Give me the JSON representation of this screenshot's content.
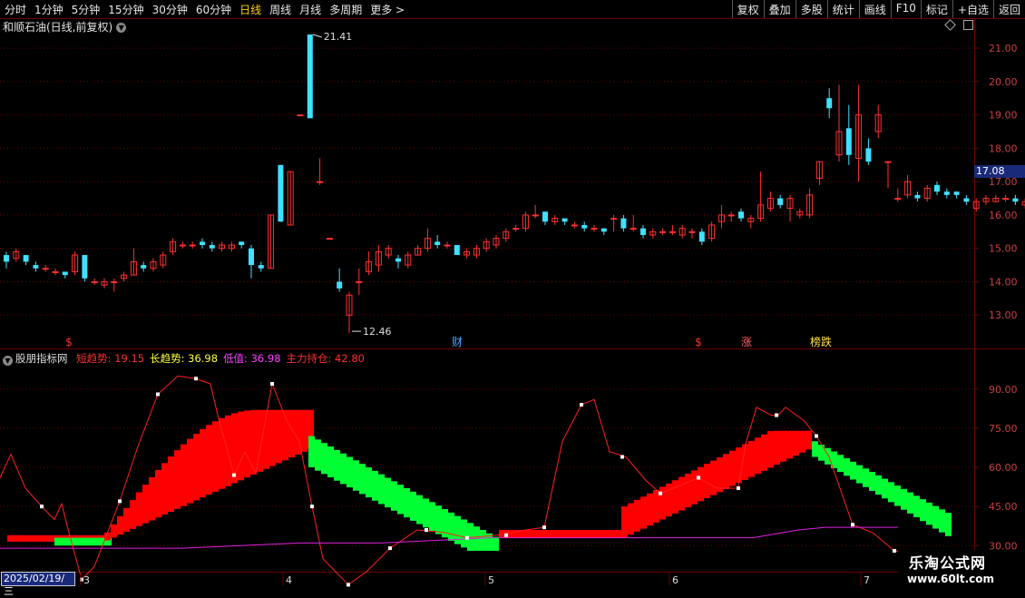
{
  "toolbar": {
    "periods": [
      "分时",
      "1分钟",
      "5分钟",
      "15分钟",
      "30分钟",
      "60分钟",
      "日线",
      "周线",
      "月线",
      "多周期",
      "更多 >"
    ],
    "active_period": "日线",
    "right_buttons": [
      "复权",
      "叠加",
      "多股",
      "统计",
      "画线",
      "F10",
      "标记",
      "+自选",
      "返回"
    ]
  },
  "chart_title": "和顺石油(日线,前复权)",
  "current_price": "17.08",
  "price_axis": {
    "ticks": [
      "21.00",
      "20.00",
      "19.00",
      "18.00",
      "17.00",
      "16.00",
      "15.00",
      "14.00",
      "13.00"
    ]
  },
  "annotations": {
    "high": "21.41",
    "low": "12.46"
  },
  "event_markers": [
    {
      "text": "$",
      "color": "#ff3030"
    },
    {
      "text": "财",
      "color": "#4aa8ff"
    },
    {
      "text": "$",
      "color": "#ff3030"
    },
    {
      "text": "涨",
      "color": "#ff6060"
    },
    {
      "text": "榜跌",
      "color": "#ffe040"
    }
  ],
  "indicator": {
    "name": "股朋指标网",
    "items": [
      {
        "label": "短趋势:",
        "value": "19.15",
        "color": "#ff3030"
      },
      {
        "label": "长趋势:",
        "value": "36.98",
        "color": "#ffff40"
      },
      {
        "label": "低值:",
        "value": "36.98",
        "color": "#ff40ff"
      },
      {
        "label": "主力持仓:",
        "value": "42.80",
        "color": "#ff3030"
      }
    ],
    "axis_ticks": [
      "90.00",
      "75.00",
      "60.00",
      "45.00",
      "30.00"
    ]
  },
  "date_axis": {
    "current_date": "2025/02/19/三",
    "months": [
      "3",
      "4",
      "5",
      "6",
      "7"
    ]
  },
  "watermark": {
    "name": "乐淘公式网",
    "url": "www.60lt.com"
  },
  "colors": {
    "up": "#ff3030",
    "down": "#40e0ff",
    "bull_band": "#ff0000",
    "bear_band": "#00ff33",
    "grid": "#6b0000"
  },
  "chart_data": {
    "type": "candlestick",
    "price_range": [
      12.0,
      21.9
    ],
    "candles": [
      [
        14.8,
        14.6,
        14.9,
        14.4
      ],
      [
        14.7,
        14.9,
        15.0,
        14.6
      ],
      [
        14.8,
        14.6,
        14.8,
        14.5
      ],
      [
        14.5,
        14.4,
        14.6,
        14.3
      ],
      [
        14.4,
        14.4,
        14.5,
        14.3
      ],
      [
        14.3,
        14.3,
        14.4,
        14.2
      ],
      [
        14.3,
        14.2,
        14.3,
        14.1
      ],
      [
        14.3,
        14.8,
        14.9,
        14.2
      ],
      [
        14.8,
        14.1,
        14.8,
        14.0
      ],
      [
        14.0,
        14.0,
        14.1,
        13.9
      ],
      [
        13.9,
        14.0,
        14.1,
        13.8
      ],
      [
        14.0,
        14.0,
        14.1,
        13.7
      ],
      [
        14.1,
        14.2,
        14.3,
        14.0
      ],
      [
        14.2,
        14.6,
        15.0,
        14.2
      ],
      [
        14.5,
        14.4,
        14.6,
        14.3
      ],
      [
        14.4,
        14.6,
        14.7,
        14.3
      ],
      [
        14.5,
        14.8,
        14.9,
        14.4
      ],
      [
        14.9,
        15.2,
        15.3,
        14.8
      ],
      [
        15.1,
        15.1,
        15.2,
        15.0
      ],
      [
        15.1,
        15.1,
        15.2,
        15.0
      ],
      [
        15.2,
        15.1,
        15.3,
        15.0
      ],
      [
        15.1,
        15.0,
        15.2,
        14.9
      ],
      [
        15.0,
        15.1,
        15.2,
        14.9
      ],
      [
        15.0,
        15.1,
        15.2,
        14.9
      ],
      [
        15.2,
        15.1,
        15.2,
        15.0
      ],
      [
        15.0,
        14.5,
        15.1,
        14.1
      ],
      [
        14.5,
        14.4,
        14.6,
        14.3
      ],
      [
        14.4,
        16.0,
        16.0,
        14.4
      ],
      [
        17.5,
        15.8,
        17.5,
        15.8
      ],
      [
        15.7,
        17.3,
        17.3,
        15.7
      ],
      [
        19.0,
        19.0,
        19.0,
        19.0
      ],
      [
        21.41,
        18.9,
        21.41,
        18.9
      ],
      [
        17.0,
        17.0,
        17.7,
        16.9
      ],
      [
        15.3,
        15.3,
        15.3,
        15.3
      ],
      [
        14.0,
        13.8,
        14.4,
        13.7
      ],
      [
        13.0,
        13.6,
        13.7,
        12.46
      ],
      [
        14.0,
        14.0,
        14.4,
        13.6
      ],
      [
        14.3,
        14.6,
        14.9,
        14.2
      ],
      [
        14.5,
        14.9,
        15.1,
        14.3
      ],
      [
        14.8,
        15.0,
        15.1,
        14.7
      ],
      [
        14.7,
        14.6,
        14.8,
        14.4
      ],
      [
        14.5,
        14.8,
        14.9,
        14.4
      ],
      [
        14.8,
        15.0,
        15.1,
        14.8
      ],
      [
        15.0,
        15.3,
        15.6,
        14.9
      ],
      [
        15.2,
        15.1,
        15.4,
        15.0
      ],
      [
        15.1,
        15.1,
        15.2,
        15.0
      ],
      [
        15.1,
        14.8,
        15.1,
        14.8
      ],
      [
        14.8,
        14.9,
        15.0,
        14.7
      ],
      [
        14.8,
        15.0,
        15.1,
        14.7
      ],
      [
        15.0,
        15.2,
        15.3,
        14.9
      ],
      [
        15.1,
        15.3,
        15.4,
        15.0
      ],
      [
        15.3,
        15.5,
        15.6,
        15.2
      ],
      [
        15.6,
        15.6,
        15.7,
        15.5
      ],
      [
        15.6,
        16.0,
        16.1,
        15.5
      ],
      [
        16.0,
        16.0,
        16.3,
        15.9
      ],
      [
        16.1,
        15.8,
        16.1,
        15.7
      ],
      [
        15.8,
        15.9,
        16.0,
        15.7
      ],
      [
        15.9,
        15.8,
        15.9,
        15.7
      ],
      [
        15.7,
        15.7,
        15.8,
        15.6
      ],
      [
        15.7,
        15.6,
        15.8,
        15.5
      ],
      [
        15.6,
        15.6,
        15.7,
        15.5
      ],
      [
        15.6,
        15.5,
        15.6,
        15.4
      ],
      [
        15.9,
        15.9,
        16.0,
        15.5
      ],
      [
        15.9,
        15.6,
        16.0,
        15.5
      ],
      [
        15.6,
        15.6,
        16.0,
        15.5
      ],
      [
        15.6,
        15.4,
        15.7,
        15.3
      ],
      [
        15.4,
        15.5,
        15.6,
        15.3
      ],
      [
        15.5,
        15.5,
        15.6,
        15.4
      ],
      [
        15.5,
        15.5,
        15.7,
        15.4
      ],
      [
        15.4,
        15.6,
        15.7,
        15.3
      ],
      [
        15.5,
        15.5,
        15.6,
        15.3
      ],
      [
        15.5,
        15.2,
        15.6,
        15.1
      ],
      [
        15.3,
        15.7,
        15.8,
        15.2
      ],
      [
        15.8,
        16.0,
        16.3,
        15.6
      ],
      [
        16.0,
        16.0,
        16.1,
        15.8
      ],
      [
        16.1,
        15.9,
        16.2,
        15.8
      ],
      [
        15.8,
        15.9,
        16.0,
        15.6
      ],
      [
        15.9,
        16.3,
        17.3,
        15.8
      ],
      [
        16.2,
        16.5,
        16.7,
        16.1
      ],
      [
        16.5,
        16.3,
        16.6,
        16.2
      ],
      [
        16.2,
        16.5,
        16.6,
        15.8
      ],
      [
        16.0,
        16.1,
        16.2,
        15.9
      ],
      [
        16.0,
        16.6,
        16.8,
        15.9
      ],
      [
        17.1,
        17.6,
        17.6,
        16.9
      ],
      [
        19.5,
        19.2,
        19.8,
        18.9
      ],
      [
        17.8,
        18.5,
        19.9,
        17.6
      ],
      [
        18.6,
        17.8,
        19.3,
        17.5
      ],
      [
        17.7,
        19.0,
        19.9,
        17.0
      ],
      [
        18.0,
        17.6,
        18.3,
        17.5
      ],
      [
        18.5,
        19.0,
        19.3,
        18.3
      ],
      [
        17.6,
        17.6,
        17.6,
        16.8
      ],
      [
        16.5,
        16.5,
        16.8,
        16.4
      ],
      [
        16.6,
        17.0,
        17.2,
        16.5
      ],
      [
        16.6,
        16.5,
        16.7,
        16.4
      ],
      [
        16.5,
        16.8,
        16.9,
        16.4
      ],
      [
        16.9,
        16.7,
        17.0,
        16.6
      ],
      [
        16.7,
        16.6,
        16.8,
        16.5
      ],
      [
        16.7,
        16.6,
        16.7,
        16.5
      ],
      [
        16.5,
        16.4,
        16.6,
        16.3
      ],
      [
        16.2,
        16.4,
        16.5,
        16.1
      ],
      [
        16.4,
        16.5,
        16.6,
        16.3
      ],
      [
        16.4,
        16.5,
        16.6,
        16.4
      ],
      [
        16.5,
        16.5,
        16.6,
        16.4
      ],
      [
        16.5,
        16.4,
        16.6,
        16.3
      ],
      [
        16.3,
        16.4,
        16.5,
        16.2
      ]
    ]
  }
}
